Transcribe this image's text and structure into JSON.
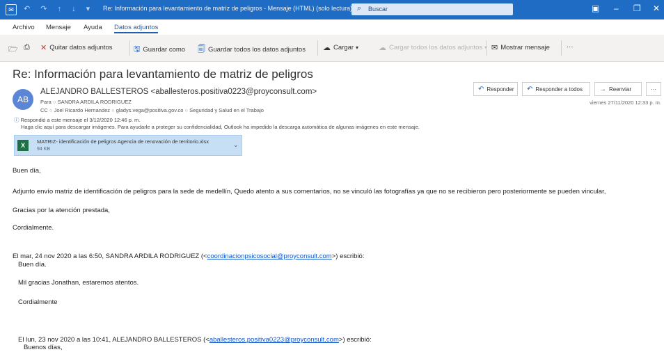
{
  "window": {
    "app_icon": "outlook-icon",
    "title": "Re: Información para levantamiento de matriz de peligros  -  Mensaje (HTML) (solo lectura)",
    "search_placeholder": "Buscar"
  },
  "menu": {
    "items": [
      "Archivo",
      "Mensaje",
      "Ayuda",
      "Datos adjuntos"
    ],
    "active": "Datos adjuntos"
  },
  "ribbon": {
    "remove": "Quitar datos adjuntos",
    "save_as": "Guardar como",
    "save_all": "Guardar todos los datos adjuntos",
    "upload": "Cargar",
    "upload_all": "Cargar todos los datos adjuntos",
    "show_message": "Mostrar mensaje",
    "more": "···"
  },
  "email": {
    "subject": "Re: Información para levantamiento de matriz de peligros",
    "avatar_initials": "AB",
    "sender": "ALEJANDRO BALLESTEROS <aballesteros.positiva0223@proyconsult.com>",
    "to_label": "Para",
    "to": "SANDRA ARDILA RODRIGUEZ",
    "cc_label": "CC",
    "cc": [
      "Joel Ricardo Hernandez",
      "gladys.vega@positiva.gov.co",
      "Seguridad y Salud en el Trabajo"
    ],
    "info_replied": "Respondió a este mensaje el 3/12/2020 12:46 p. m.",
    "info_images": "Haga clic aquí para descargar imágenes. Para ayudarle a proteger su confidencialidad, Outlook ha impedido la descarga automática de algunas imágenes en este mensaje.",
    "date": "viernes 27/11/2020 12:33 p. m.",
    "actions": {
      "reply": "Responder",
      "reply_all": "Responder a todos",
      "forward": "Reenviar",
      "more": "···"
    },
    "attachment": {
      "name": "MATRIZ- identificación de peligros Agencia de renovación de territorio.xlsx",
      "size": "94 KB"
    }
  },
  "body": {
    "greeting": "Buen día,",
    "main": "Adjunto envío matriz de identificación de peligros para la sede de medellín, Quedo atento a sus comentarios, no se vinculó las fotografías ya que no se recibieron pero posteriormente se pueden vincular,",
    "thanks": "Gracias por la atención prestada,",
    "closing": "Cordialmente.",
    "quote1_prefix": "El mar, 24 nov 2020 a las 6:50, SANDRA ARDILA RODRIGUEZ (<",
    "quote1_email": "coordinacionpsicosocial@proyconsult.com",
    "quote1_suffix": ">) escribió:",
    "q1_greeting": "Buen día.",
    "q1_body": "Mil gracias Jonathan, estaremos atentos.",
    "q1_closing": "Cordialmente",
    "quote2_prefix": "El lun, 23 nov 2020 a las 10:41, ALEJANDRO BALLESTEROS (<",
    "quote2_email": "aballesteros.positiva0223@proyconsult.com",
    "quote2_suffix": ">) escribió:",
    "q2_greeting": "Buenos días,"
  }
}
